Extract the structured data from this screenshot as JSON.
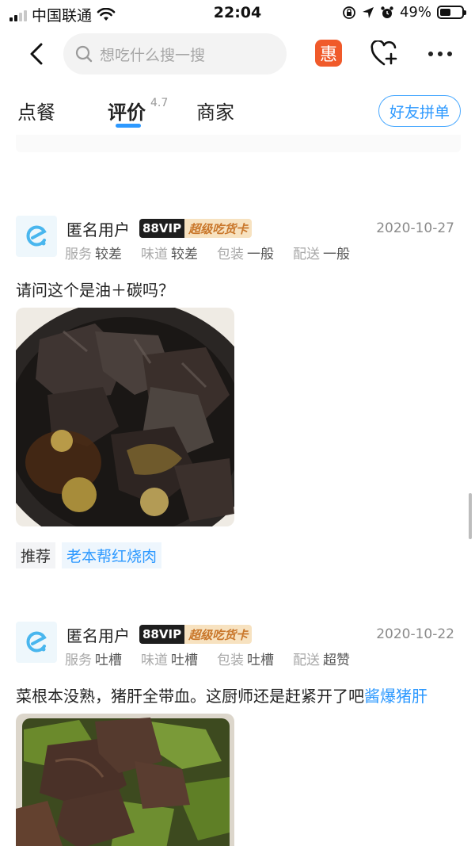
{
  "status_bar": {
    "carrier": "中国联通",
    "time": "22:04",
    "battery": "49%",
    "battery_level": 0.49
  },
  "header": {
    "search_placeholder": "想吃什么搜一搜",
    "promo_badge": "惠"
  },
  "tabs": [
    {
      "label": "点餐"
    },
    {
      "label": "评价",
      "rating": "4.7"
    },
    {
      "label": "商家"
    }
  ],
  "group_order_button": "好友拼单",
  "reviews": [
    {
      "user": "匿名用户",
      "vip": "88VIP",
      "badge": "超级吃货卡",
      "date": "2020-10-27",
      "scores": [
        {
          "k": "服务",
          "v": "较差"
        },
        {
          "k": "味道",
          "v": "较差"
        },
        {
          "k": "包装",
          "v": "一般"
        },
        {
          "k": "配送",
          "v": "一般"
        }
      ],
      "text": "请问这个是油＋碳吗？",
      "recommend_label": "推荐",
      "recommend_dish": "老本帮红烧肉"
    },
    {
      "user": "匿名用户",
      "vip": "88VIP",
      "badge": "超级吃货卡",
      "date": "2020-10-22",
      "scores": [
        {
          "k": "服务",
          "v": "吐槽"
        },
        {
          "k": "味道",
          "v": "吐槽"
        },
        {
          "k": "包装",
          "v": "吐槽"
        },
        {
          "k": "配送",
          "v": "超赞"
        }
      ],
      "text": "菜根本没熟，猪肝全带血。这厨师还是赶紧开了吧",
      "dish_tag": "酱爆猪肝"
    }
  ],
  "colors": {
    "accent": "#2d99ff",
    "promo": "#f05a2a",
    "vip_gold": "#c9772b"
  },
  "icons": [
    "back-icon",
    "search-icon",
    "heart-plus-icon",
    "more-icon",
    "wifi-icon",
    "location-icon",
    "alarm-icon",
    "lock-rotation-icon"
  ]
}
